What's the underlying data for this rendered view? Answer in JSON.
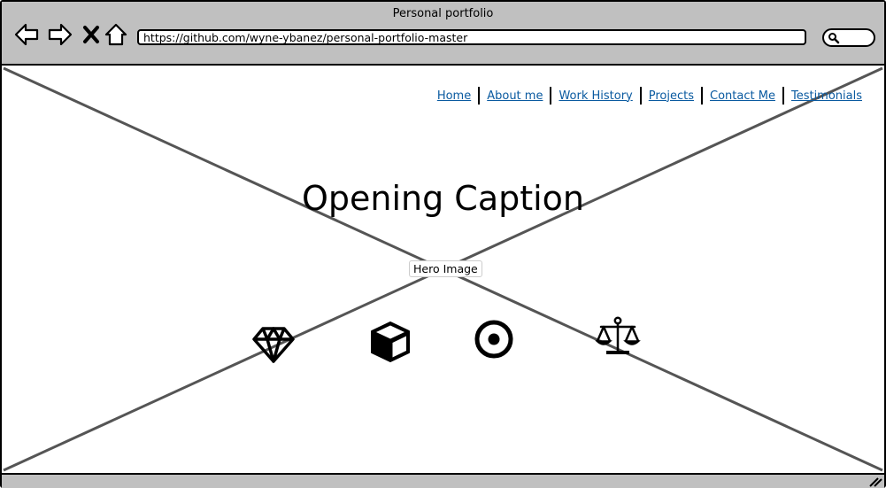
{
  "window": {
    "title": "Personal portfolio",
    "address": "https://github.com/wyne-ybanez/personal-portfolio-master"
  },
  "toolbar": {
    "buttons": [
      {
        "name": "back-arrow-icon"
      },
      {
        "name": "forward-arrow-icon"
      },
      {
        "name": "close-icon"
      },
      {
        "name": "home-icon"
      }
    ],
    "search_icon": "search-icon"
  },
  "nav": {
    "links": [
      "Home",
      "About me",
      "Work History",
      "Projects",
      "Contact Me",
      "Testimonials"
    ],
    "link_color": "#0a5aa0"
  },
  "hero": {
    "caption": "Opening Caption",
    "image_label": "Hero Image"
  },
  "features": {
    "icons": [
      "diamond-icon",
      "cube-icon",
      "target-icon",
      "balance-scale-icon"
    ]
  },
  "colors": {
    "chrome": "#c0c0c0",
    "placeholder_lines": "#555555"
  }
}
